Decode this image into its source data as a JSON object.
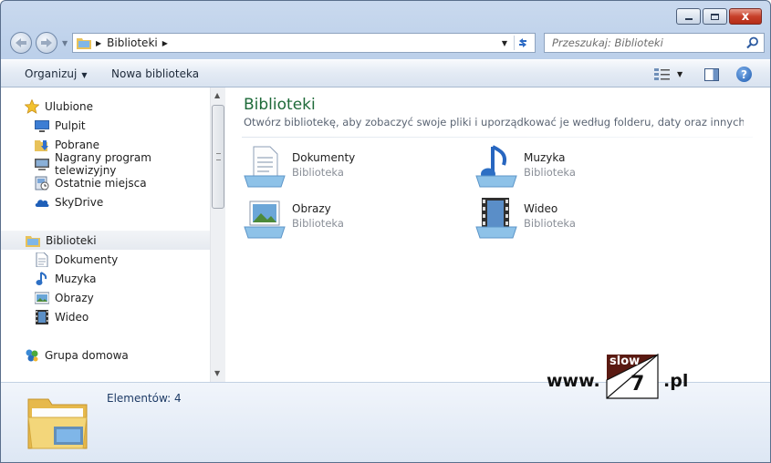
{
  "window": {
    "caption_buttons": {
      "minimize_icon": "minimize-icon",
      "maximize_icon": "maximize-icon",
      "close_icon": "close-icon",
      "close_glyph": "x"
    }
  },
  "address": {
    "path": [
      "Biblioteki"
    ],
    "back_icon": "back-arrow-icon",
    "forward_icon": "forward-arrow-icon",
    "refresh_icon": "refresh-icon"
  },
  "search": {
    "placeholder": "Przeszukaj: Biblioteki",
    "icon": "search-icon"
  },
  "toolbar": {
    "organize_label": "Organizuj",
    "new_library_label": "Nowa biblioteka",
    "view_icon": "view-options-icon",
    "preview_pane_icon": "preview-pane-icon",
    "help_icon": "help-icon",
    "help_glyph": "?"
  },
  "navpane": {
    "favorites": {
      "label": "Ulubione",
      "icon": "star-icon"
    },
    "favorite_items": [
      {
        "label": "Pulpit",
        "icon": "desktop-icon"
      },
      {
        "label": "Pobrane",
        "icon": "downloads-icon"
      },
      {
        "label": "Nagrany program telewizyjny",
        "icon": "recorded-tv-icon"
      },
      {
        "label": "Ostatnie miejsca",
        "icon": "recent-places-icon"
      },
      {
        "label": "SkyDrive",
        "icon": "skydrive-icon"
      }
    ],
    "libraries": {
      "label": "Biblioteki",
      "icon": "libraries-icon",
      "selected": true
    },
    "library_items": [
      {
        "label": "Dokumenty",
        "icon": "documents-icon"
      },
      {
        "label": "Muzyka",
        "icon": "music-icon"
      },
      {
        "label": "Obrazy",
        "icon": "pictures-icon"
      },
      {
        "label": "Wideo",
        "icon": "video-icon"
      }
    ],
    "homegroup": {
      "label": "Grupa domowa",
      "icon": "homegroup-icon"
    }
  },
  "content": {
    "title": "Biblioteki",
    "description": "Otwórz bibliotekę, aby zobaczyć swoje pliki i uporządkować je według folderu, daty oraz innych właśc...",
    "libraries": [
      {
        "name": "Dokumenty",
        "type": "Biblioteka",
        "icon": "documents-library-icon"
      },
      {
        "name": "Muzyka",
        "type": "Biblioteka",
        "icon": "music-library-icon"
      },
      {
        "name": "Obrazy",
        "type": "Biblioteka",
        "icon": "pictures-library-icon"
      },
      {
        "name": "Wideo",
        "type": "Biblioteka",
        "icon": "video-library-icon"
      }
    ]
  },
  "details": {
    "count_text": "Elementów: 4",
    "icon": "libraries-folder-icon"
  },
  "watermark": {
    "prefix": "www.",
    "box_top": "slow",
    "box_digit": "7",
    "suffix": ".pl"
  }
}
